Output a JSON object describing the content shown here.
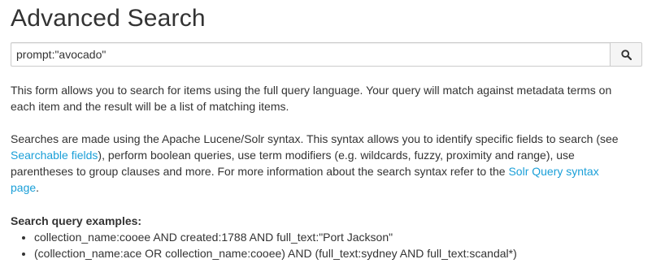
{
  "page_title": "Advanced Search",
  "search": {
    "value": "prompt:\"avocado\"",
    "button_icon": "search-icon"
  },
  "intro": {
    "text": "This form allows you to search for items using the full query language. Your query will match against metadata terms on each item and the result will be a list of matching items."
  },
  "syntax": {
    "text_1": "Searches are made using the Apache Lucene/Solr syntax. This syntax allows you to identify specific fields to search (see ",
    "link_searchable_fields": "Searchable fields",
    "text_2": "), perform boolean queries, use term modifiers (e.g. wildcards, fuzzy, proximity and range), use parentheses to group clauses and more. For more information about the search syntax refer to the ",
    "link_solr_query": "Solr Query syntax page",
    "text_3": "."
  },
  "examples": {
    "title": "Search query examples:",
    "items": [
      "collection_name:cooee AND created:1788 AND full_text:\"Port Jackson\"",
      "(collection_name:ace OR collection_name:cooee) AND (full_text:sydney AND full_text:scandal*)"
    ]
  },
  "colors": {
    "link": "#1a9fd8",
    "text": "#333333",
    "border": "#cccccc",
    "button_bg": "#f5f5f5"
  }
}
